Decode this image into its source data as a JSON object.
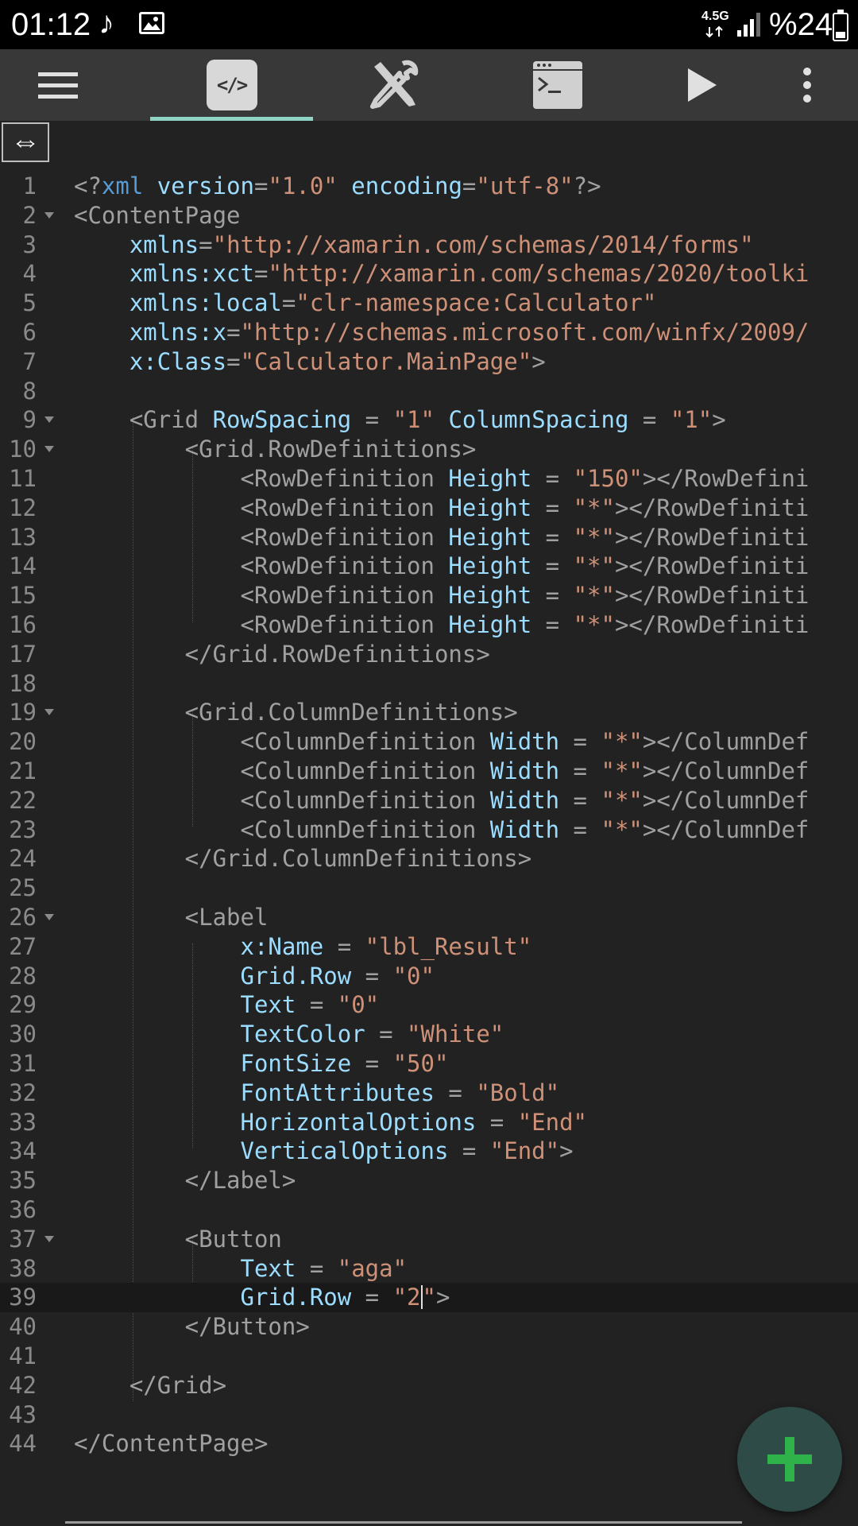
{
  "status_bar": {
    "time": "01:12",
    "note_glyph": "♪",
    "network": "4.5G",
    "battery": "%24",
    "icons": [
      "music-note-icon",
      "gallery-icon",
      "data-arrows-icon",
      "signal-icon",
      "battery-icon"
    ]
  },
  "toolbar": {
    "code_tab_label": "</>",
    "icons": [
      "hamburger-menu-icon",
      "code-tab-icon",
      "tools-icon",
      "terminal-icon",
      "play-icon",
      "more-vert-icon"
    ],
    "active_tab_color": "#8fd3c4"
  },
  "resize_handle": {
    "glyph": "⇔"
  },
  "editor": {
    "current_line": 39,
    "lines": [
      {
        "n": "1",
        "fold": false,
        "segs": [
          [
            "t",
            "<?"
          ],
          [
            "k",
            "xml"
          ],
          [
            "a",
            " version"
          ],
          [
            "t",
            "="
          ],
          [
            "s",
            "\"1.0\""
          ],
          [
            "a",
            " encoding"
          ],
          [
            "t",
            "="
          ],
          [
            "s",
            "\"utf-8\""
          ],
          [
            "t",
            "?>"
          ]
        ]
      },
      {
        "n": "2",
        "fold": true,
        "segs": [
          [
            "t",
            "<ContentPage"
          ]
        ]
      },
      {
        "n": "3",
        "fold": false,
        "segs": [
          [
            "a",
            "    xmlns"
          ],
          [
            "t",
            "="
          ],
          [
            "s",
            "\"http://xamarin.com/schemas/2014/forms\""
          ]
        ]
      },
      {
        "n": "4",
        "fold": false,
        "segs": [
          [
            "a",
            "    xmlns:xct"
          ],
          [
            "t",
            "="
          ],
          [
            "s",
            "\"http://xamarin.com/schemas/2020/toolki"
          ]
        ]
      },
      {
        "n": "5",
        "fold": false,
        "segs": [
          [
            "a",
            "    xmlns:local"
          ],
          [
            "t",
            "="
          ],
          [
            "s",
            "\"clr-namespace:Calculator\""
          ]
        ]
      },
      {
        "n": "6",
        "fold": false,
        "segs": [
          [
            "a",
            "    xmlns:x"
          ],
          [
            "t",
            "="
          ],
          [
            "s",
            "\"http://schemas.microsoft.com/winfx/2009/"
          ]
        ]
      },
      {
        "n": "7",
        "fold": false,
        "segs": [
          [
            "a",
            "    x:Class"
          ],
          [
            "t",
            "="
          ],
          [
            "s",
            "\"Calculator.MainPage\""
          ],
          [
            "t",
            ">"
          ]
        ]
      },
      {
        "n": "8",
        "fold": false,
        "segs": []
      },
      {
        "n": "9",
        "fold": true,
        "segs": [
          [
            "t",
            "    <Grid"
          ],
          [
            "a",
            " RowSpacing"
          ],
          [
            "t",
            " = "
          ],
          [
            "s",
            "\"1\""
          ],
          [
            "a",
            " ColumnSpacing"
          ],
          [
            "t",
            " = "
          ],
          [
            "s",
            "\"1\""
          ],
          [
            "t",
            ">"
          ]
        ]
      },
      {
        "n": "10",
        "fold": true,
        "segs": [
          [
            "t",
            "        <Grid.RowDefinitions>"
          ]
        ]
      },
      {
        "n": "11",
        "fold": false,
        "segs": [
          [
            "t",
            "            <RowDefinition"
          ],
          [
            "a",
            " Height"
          ],
          [
            "t",
            " = "
          ],
          [
            "s",
            "\"150\""
          ],
          [
            "t",
            "></RowDefini"
          ]
        ]
      },
      {
        "n": "12",
        "fold": false,
        "segs": [
          [
            "t",
            "            <RowDefinition"
          ],
          [
            "a",
            " Height"
          ],
          [
            "t",
            " = "
          ],
          [
            "s",
            "\"*\""
          ],
          [
            "t",
            "></RowDefiniti"
          ]
        ]
      },
      {
        "n": "13",
        "fold": false,
        "segs": [
          [
            "t",
            "            <RowDefinition"
          ],
          [
            "a",
            " Height"
          ],
          [
            "t",
            " = "
          ],
          [
            "s",
            "\"*\""
          ],
          [
            "t",
            "></RowDefiniti"
          ]
        ]
      },
      {
        "n": "14",
        "fold": false,
        "segs": [
          [
            "t",
            "            <RowDefinition"
          ],
          [
            "a",
            " Height"
          ],
          [
            "t",
            " = "
          ],
          [
            "s",
            "\"*\""
          ],
          [
            "t",
            "></RowDefiniti"
          ]
        ]
      },
      {
        "n": "15",
        "fold": false,
        "segs": [
          [
            "t",
            "            <RowDefinition"
          ],
          [
            "a",
            " Height"
          ],
          [
            "t",
            " = "
          ],
          [
            "s",
            "\"*\""
          ],
          [
            "t",
            "></RowDefiniti"
          ]
        ]
      },
      {
        "n": "16",
        "fold": false,
        "segs": [
          [
            "t",
            "            <RowDefinition"
          ],
          [
            "a",
            " Height"
          ],
          [
            "t",
            " = "
          ],
          [
            "s",
            "\"*\""
          ],
          [
            "t",
            "></RowDefiniti"
          ]
        ]
      },
      {
        "n": "17",
        "fold": false,
        "segs": [
          [
            "t",
            "        </Grid.RowDefinitions>"
          ]
        ]
      },
      {
        "n": "18",
        "fold": false,
        "segs": []
      },
      {
        "n": "19",
        "fold": true,
        "segs": [
          [
            "t",
            "        <Grid.ColumnDefinitions>"
          ]
        ]
      },
      {
        "n": "20",
        "fold": false,
        "segs": [
          [
            "t",
            "            <ColumnDefinition"
          ],
          [
            "a",
            " Width"
          ],
          [
            "t",
            " = "
          ],
          [
            "s",
            "\"*\""
          ],
          [
            "t",
            "></ColumnDef"
          ]
        ]
      },
      {
        "n": "21",
        "fold": false,
        "segs": [
          [
            "t",
            "            <ColumnDefinition"
          ],
          [
            "a",
            " Width"
          ],
          [
            "t",
            " = "
          ],
          [
            "s",
            "\"*\""
          ],
          [
            "t",
            "></ColumnDef"
          ]
        ]
      },
      {
        "n": "22",
        "fold": false,
        "segs": [
          [
            "t",
            "            <ColumnDefinition"
          ],
          [
            "a",
            " Width"
          ],
          [
            "t",
            " = "
          ],
          [
            "s",
            "\"*\""
          ],
          [
            "t",
            "></ColumnDef"
          ]
        ]
      },
      {
        "n": "23",
        "fold": false,
        "segs": [
          [
            "t",
            "            <ColumnDefinition"
          ],
          [
            "a",
            " Width"
          ],
          [
            "t",
            " = "
          ],
          [
            "s",
            "\"*\""
          ],
          [
            "t",
            "></ColumnDef"
          ]
        ]
      },
      {
        "n": "24",
        "fold": false,
        "segs": [
          [
            "t",
            "        </Grid.ColumnDefinitions>"
          ]
        ]
      },
      {
        "n": "25",
        "fold": false,
        "segs": []
      },
      {
        "n": "26",
        "fold": true,
        "segs": [
          [
            "t",
            "        <Label"
          ]
        ]
      },
      {
        "n": "27",
        "fold": false,
        "segs": [
          [
            "a",
            "            x:Name"
          ],
          [
            "t",
            " = "
          ],
          [
            "s",
            "\"lbl_Result\""
          ]
        ]
      },
      {
        "n": "28",
        "fold": false,
        "segs": [
          [
            "a",
            "            Grid.Row"
          ],
          [
            "t",
            " = "
          ],
          [
            "s",
            "\"0\""
          ]
        ]
      },
      {
        "n": "29",
        "fold": false,
        "segs": [
          [
            "a",
            "            Text"
          ],
          [
            "t",
            " = "
          ],
          [
            "s",
            "\"0\""
          ]
        ]
      },
      {
        "n": "30",
        "fold": false,
        "segs": [
          [
            "a",
            "            TextColor"
          ],
          [
            "t",
            " = "
          ],
          [
            "s",
            "\"White\""
          ]
        ]
      },
      {
        "n": "31",
        "fold": false,
        "segs": [
          [
            "a",
            "            FontSize"
          ],
          [
            "t",
            " = "
          ],
          [
            "s",
            "\"50\""
          ]
        ]
      },
      {
        "n": "32",
        "fold": false,
        "segs": [
          [
            "a",
            "            FontAttributes"
          ],
          [
            "t",
            " = "
          ],
          [
            "s",
            "\"Bold\""
          ]
        ]
      },
      {
        "n": "33",
        "fold": false,
        "segs": [
          [
            "a",
            "            HorizontalOptions"
          ],
          [
            "t",
            " = "
          ],
          [
            "s",
            "\"End\""
          ]
        ]
      },
      {
        "n": "34",
        "fold": false,
        "segs": [
          [
            "a",
            "            VerticalOptions"
          ],
          [
            "t",
            " = "
          ],
          [
            "s",
            "\"End\""
          ],
          [
            "t",
            ">"
          ]
        ]
      },
      {
        "n": "35",
        "fold": false,
        "segs": [
          [
            "t",
            "        </Label>"
          ]
        ]
      },
      {
        "n": "36",
        "fold": false,
        "segs": []
      },
      {
        "n": "37",
        "fold": true,
        "segs": [
          [
            "t",
            "        <Button"
          ]
        ]
      },
      {
        "n": "38",
        "fold": false,
        "segs": [
          [
            "a",
            "            Text"
          ],
          [
            "t",
            " = "
          ],
          [
            "s",
            "\"aga\""
          ]
        ]
      },
      {
        "n": "39",
        "fold": false,
        "segs": [
          [
            "a",
            "            Grid.Row"
          ],
          [
            "t",
            " = "
          ],
          [
            "s",
            "\"2"
          ],
          [
            "cursor",
            ""
          ],
          [
            "s",
            "\""
          ],
          [
            "t",
            ">"
          ]
        ]
      },
      {
        "n": "40",
        "fold": false,
        "segs": [
          [
            "t",
            "        </Button>"
          ]
        ]
      },
      {
        "n": "41",
        "fold": false,
        "segs": []
      },
      {
        "n": "42",
        "fold": false,
        "segs": [
          [
            "t",
            "    </Grid>"
          ]
        ]
      },
      {
        "n": "43",
        "fold": false,
        "segs": []
      },
      {
        "n": "44",
        "fold": false,
        "segs": [
          [
            "t",
            "</ContentPage>"
          ]
        ]
      }
    ]
  },
  "fab": {
    "glyph": "+",
    "icon": "add-icon",
    "color": "#2fb24a"
  }
}
